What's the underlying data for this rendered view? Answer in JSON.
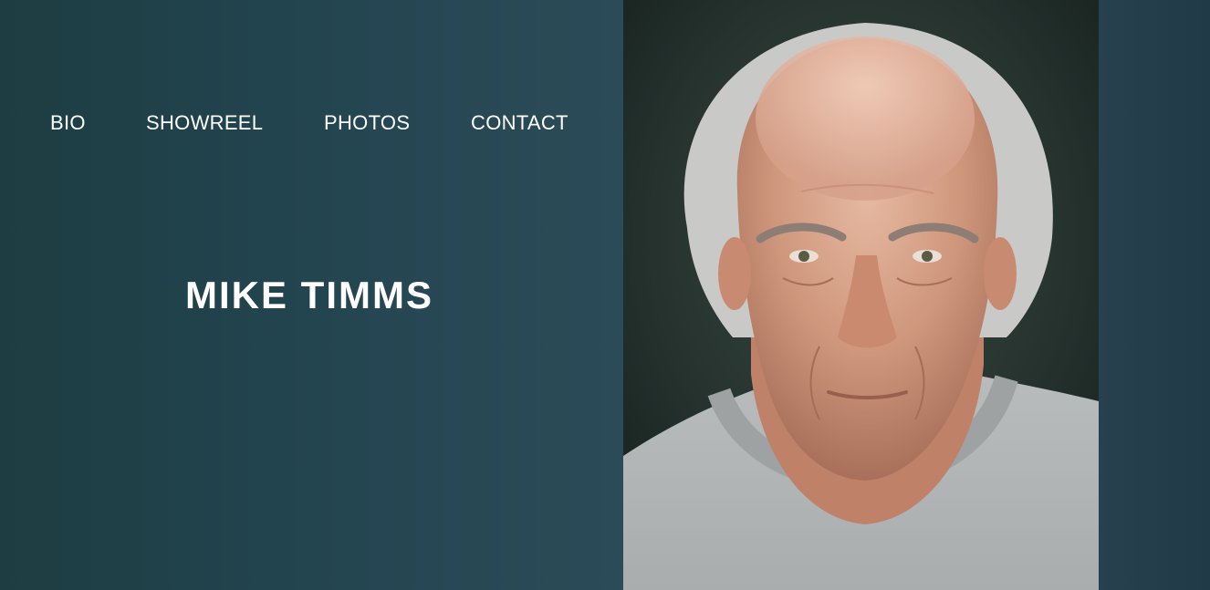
{
  "nav": {
    "items": [
      {
        "label": "BIO"
      },
      {
        "label": "SHOWREEL"
      },
      {
        "label": "PHOTOS"
      },
      {
        "label": "CONTACT"
      }
    ]
  },
  "hero": {
    "title": "MIKE TIMMS"
  },
  "colors": {
    "panel_bg": "#234550",
    "text": "#ffffff",
    "right_strip": "#203a48"
  }
}
